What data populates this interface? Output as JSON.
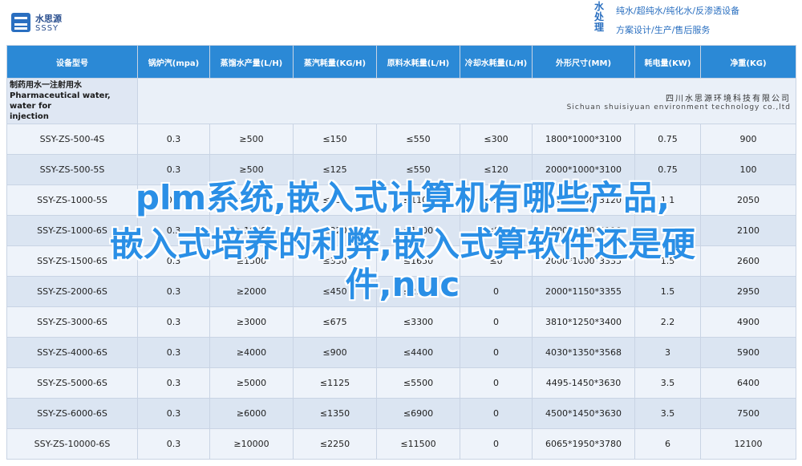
{
  "header": {
    "logo_cn": "水思源",
    "logo_en": "SSSY",
    "brand_vertical": [
      "水",
      "处",
      "理"
    ],
    "slogan_line1": "纯水/超纯水/纯化水/反渗透设备",
    "slogan_line2": "方案设计/生产/售后服务"
  },
  "caption": {
    "left_line1": "制药用水一注射用水",
    "left_line2": "Pharmaceutical water, water for",
    "left_line3": "injection",
    "company_cn": "四川水思源环境科技有限公司",
    "company_en": "Sichuan shuisiyuan environment technology co.,ltd"
  },
  "columns": [
    "设备型号",
    "锅炉汽(mpa)",
    "蒸馏水产量(L/H)",
    "蒸汽耗量(KG/H)",
    "原料水耗量(L/H)",
    "冷却水耗量(L/H)",
    "外形尺寸(MM)",
    "耗电量(KW)",
    "净重(KG)"
  ],
  "rows": [
    [
      "SSY-ZS-500-4S",
      "0.3",
      "≥500",
      "≤150",
      "≤550",
      "≤300",
      "1800*1000*3100",
      "0.75",
      "900"
    ],
    [
      "SSY-ZS-500-5S",
      "0.3",
      "≥500",
      "≤125",
      "≤550",
      "≤120",
      "2000*1000*3100",
      "0.75",
      "100"
    ],
    [
      "SSY-ZS-1000-5S",
      "0.3",
      "≥1000",
      "≤250",
      "≤1100",
      "≤240",
      "2000*1000*3120",
      "1.1",
      "2050"
    ],
    [
      "SSY-ZS-1000-6S",
      "0.3",
      "≥1000",
      "≤220",
      "≤1100",
      "≤80",
      "2000*1000*3118",
      "1.1",
      "2100"
    ],
    [
      "SSY-ZS-1500-6S",
      "0.3",
      "≥1500",
      "≤330",
      "≤1650",
      "≤0",
      "2000*1000*3335",
      "1.5",
      "2600"
    ],
    [
      "SSY-ZS-2000-6S",
      "0.3",
      "≥2000",
      "≤450",
      "≤2200",
      "0",
      "2000*1150*3355",
      "1.5",
      "2950"
    ],
    [
      "SSY-ZS-3000-6S",
      "0.3",
      "≥3000",
      "≤675",
      "≤3300",
      "0",
      "3810*1250*3400",
      "2.2",
      "4900"
    ],
    [
      "SSY-ZS-4000-6S",
      "0.3",
      "≥4000",
      "≤900",
      "≤4400",
      "0",
      "4030*1350*3568",
      "3",
      "5900"
    ],
    [
      "SSY-ZS-5000-6S",
      "0.3",
      "≥5000",
      "≤1125",
      "≤5500",
      "0",
      "4495-1450*3630",
      "3.5",
      "6400"
    ],
    [
      "SSY-ZS-6000-6S",
      "0.3",
      "≥6000",
      "≤1350",
      "≤6900",
      "0",
      "4500*1450*3630",
      "3.5",
      "7500"
    ],
    [
      "SSY-ZS-10000-6S",
      "0.3",
      "≥10000",
      "≤2250",
      "≤11500",
      "0",
      "6065*1950*3780",
      "6",
      "12100"
    ]
  ],
  "overlay": {
    "line1": "plm系统,嵌入式计算机有哪些产品,",
    "line2": "嵌入式培养的利弊,嵌入式算软件还是硬",
    "line3": "件,nuc"
  },
  "colors": {
    "header_blue": "#2b89d6",
    "row_light": "#eef3fa",
    "row_dark": "#dbe5f2",
    "overlay_text": "#2a8fe6"
  }
}
